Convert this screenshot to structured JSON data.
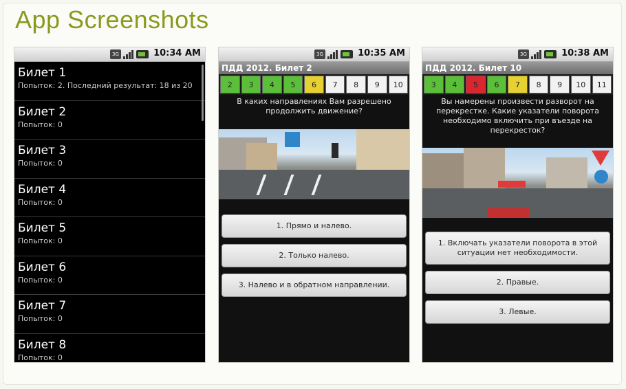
{
  "page": {
    "title": "App Screenshots"
  },
  "colors": {
    "title": "#8a9a1e",
    "green": "#5bbf3a",
    "yellow": "#e6d130",
    "red": "#d9262f",
    "white": "#f2f2f2"
  },
  "phone1": {
    "time": "10:34 AM",
    "tickets": [
      {
        "name": "Билет 1",
        "sub": "Попыток: 2. Последний результат: 18 из 20"
      },
      {
        "name": "Билет 2",
        "sub": "Попыток: 0"
      },
      {
        "name": "Билет 3",
        "sub": "Попыток: 0"
      },
      {
        "name": "Билет 4",
        "sub": "Попыток: 0"
      },
      {
        "name": "Билет 5",
        "sub": "Попыток: 0"
      },
      {
        "name": "Билет 6",
        "sub": "Попыток: 0"
      },
      {
        "name": "Билет 7",
        "sub": "Попыток: 0"
      },
      {
        "name": "Билет 8",
        "sub": "Попыток: 0"
      }
    ]
  },
  "phone2": {
    "time": "10:35 AM",
    "title": "ПДД 2012. Билет 2",
    "cells": [
      {
        "label": "2",
        "state": "green"
      },
      {
        "label": "3",
        "state": "green"
      },
      {
        "label": "4",
        "state": "green"
      },
      {
        "label": "5",
        "state": "green"
      },
      {
        "label": "6",
        "state": "yellow"
      },
      {
        "label": "7",
        "state": "white"
      },
      {
        "label": "8",
        "state": "white"
      },
      {
        "label": "9",
        "state": "white"
      },
      {
        "label": "10",
        "state": "white"
      }
    ],
    "question": "В каких направлениях Вам разрешено продолжить движение?",
    "answers": [
      "1. Прямо и налево.",
      "2. Только налево.",
      "3. Налево и в обратном направлении."
    ]
  },
  "phone3": {
    "time": "10:38 AM",
    "title": "ПДД 2012. Билет 10",
    "cells": [
      {
        "label": "3",
        "state": "green"
      },
      {
        "label": "4",
        "state": "green"
      },
      {
        "label": "5",
        "state": "red"
      },
      {
        "label": "6",
        "state": "green"
      },
      {
        "label": "7",
        "state": "yellow"
      },
      {
        "label": "8",
        "state": "white"
      },
      {
        "label": "9",
        "state": "white"
      },
      {
        "label": "10",
        "state": "white"
      },
      {
        "label": "11",
        "state": "white"
      }
    ],
    "question": "Вы намерены произвести разворот на перекрестке. Какие указатели поворота необходимо включить при въезде на перекресток?",
    "answers": [
      "1. Включать указатели поворота в этой ситуации нет необходимости.",
      "2. Правые.",
      "3. Левые."
    ]
  }
}
